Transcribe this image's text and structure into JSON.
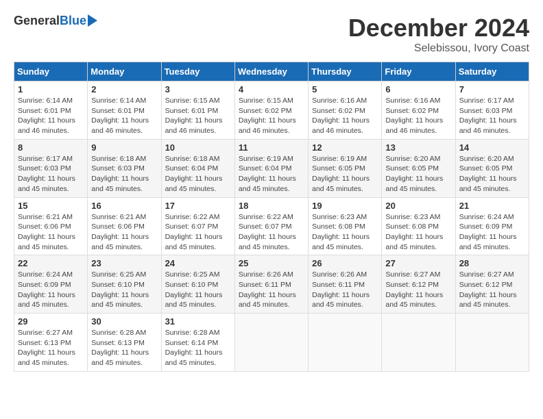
{
  "logo": {
    "general": "General",
    "blue": "Blue"
  },
  "title": "December 2024",
  "location": "Selebissou, Ivory Coast",
  "weekdays": [
    "Sunday",
    "Monday",
    "Tuesday",
    "Wednesday",
    "Thursday",
    "Friday",
    "Saturday"
  ],
  "weeks": [
    [
      {
        "day": "1",
        "sunrise": "6:14 AM",
        "sunset": "6:01 PM",
        "daylight": "11 hours and 46 minutes."
      },
      {
        "day": "2",
        "sunrise": "6:14 AM",
        "sunset": "6:01 PM",
        "daylight": "11 hours and 46 minutes."
      },
      {
        "day": "3",
        "sunrise": "6:15 AM",
        "sunset": "6:01 PM",
        "daylight": "11 hours and 46 minutes."
      },
      {
        "day": "4",
        "sunrise": "6:15 AM",
        "sunset": "6:02 PM",
        "daylight": "11 hours and 46 minutes."
      },
      {
        "day": "5",
        "sunrise": "6:16 AM",
        "sunset": "6:02 PM",
        "daylight": "11 hours and 46 minutes."
      },
      {
        "day": "6",
        "sunrise": "6:16 AM",
        "sunset": "6:02 PM",
        "daylight": "11 hours and 46 minutes."
      },
      {
        "day": "7",
        "sunrise": "6:17 AM",
        "sunset": "6:03 PM",
        "daylight": "11 hours and 46 minutes."
      }
    ],
    [
      {
        "day": "8",
        "sunrise": "6:17 AM",
        "sunset": "6:03 PM",
        "daylight": "11 hours and 45 minutes."
      },
      {
        "day": "9",
        "sunrise": "6:18 AM",
        "sunset": "6:03 PM",
        "daylight": "11 hours and 45 minutes."
      },
      {
        "day": "10",
        "sunrise": "6:18 AM",
        "sunset": "6:04 PM",
        "daylight": "11 hours and 45 minutes."
      },
      {
        "day": "11",
        "sunrise": "6:19 AM",
        "sunset": "6:04 PM",
        "daylight": "11 hours and 45 minutes."
      },
      {
        "day": "12",
        "sunrise": "6:19 AM",
        "sunset": "6:05 PM",
        "daylight": "11 hours and 45 minutes."
      },
      {
        "day": "13",
        "sunrise": "6:20 AM",
        "sunset": "6:05 PM",
        "daylight": "11 hours and 45 minutes."
      },
      {
        "day": "14",
        "sunrise": "6:20 AM",
        "sunset": "6:05 PM",
        "daylight": "11 hours and 45 minutes."
      }
    ],
    [
      {
        "day": "15",
        "sunrise": "6:21 AM",
        "sunset": "6:06 PM",
        "daylight": "11 hours and 45 minutes."
      },
      {
        "day": "16",
        "sunrise": "6:21 AM",
        "sunset": "6:06 PM",
        "daylight": "11 hours and 45 minutes."
      },
      {
        "day": "17",
        "sunrise": "6:22 AM",
        "sunset": "6:07 PM",
        "daylight": "11 hours and 45 minutes."
      },
      {
        "day": "18",
        "sunrise": "6:22 AM",
        "sunset": "6:07 PM",
        "daylight": "11 hours and 45 minutes."
      },
      {
        "day": "19",
        "sunrise": "6:23 AM",
        "sunset": "6:08 PM",
        "daylight": "11 hours and 45 minutes."
      },
      {
        "day": "20",
        "sunrise": "6:23 AM",
        "sunset": "6:08 PM",
        "daylight": "11 hours and 45 minutes."
      },
      {
        "day": "21",
        "sunrise": "6:24 AM",
        "sunset": "6:09 PM",
        "daylight": "11 hours and 45 minutes."
      }
    ],
    [
      {
        "day": "22",
        "sunrise": "6:24 AM",
        "sunset": "6:09 PM",
        "daylight": "11 hours and 45 minutes."
      },
      {
        "day": "23",
        "sunrise": "6:25 AM",
        "sunset": "6:10 PM",
        "daylight": "11 hours and 45 minutes."
      },
      {
        "day": "24",
        "sunrise": "6:25 AM",
        "sunset": "6:10 PM",
        "daylight": "11 hours and 45 minutes."
      },
      {
        "day": "25",
        "sunrise": "6:26 AM",
        "sunset": "6:11 PM",
        "daylight": "11 hours and 45 minutes."
      },
      {
        "day": "26",
        "sunrise": "6:26 AM",
        "sunset": "6:11 PM",
        "daylight": "11 hours and 45 minutes."
      },
      {
        "day": "27",
        "sunrise": "6:27 AM",
        "sunset": "6:12 PM",
        "daylight": "11 hours and 45 minutes."
      },
      {
        "day": "28",
        "sunrise": "6:27 AM",
        "sunset": "6:12 PM",
        "daylight": "11 hours and 45 minutes."
      }
    ],
    [
      {
        "day": "29",
        "sunrise": "6:27 AM",
        "sunset": "6:13 PM",
        "daylight": "11 hours and 45 minutes."
      },
      {
        "day": "30",
        "sunrise": "6:28 AM",
        "sunset": "6:13 PM",
        "daylight": "11 hours and 45 minutes."
      },
      {
        "day": "31",
        "sunrise": "6:28 AM",
        "sunset": "6:14 PM",
        "daylight": "11 hours and 45 minutes."
      },
      null,
      null,
      null,
      null
    ]
  ]
}
